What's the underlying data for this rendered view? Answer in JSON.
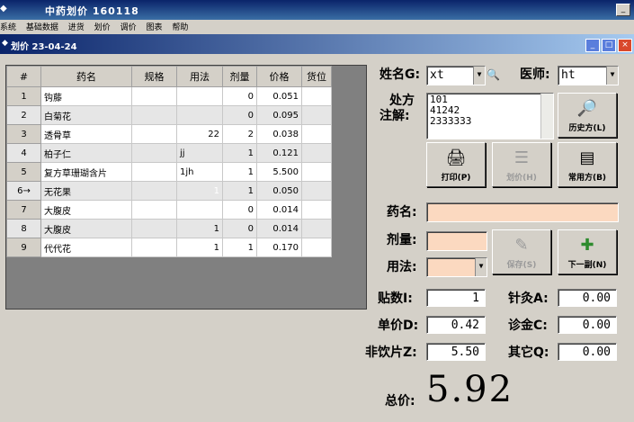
{
  "app": {
    "title": "中药划价 160118",
    "menu": [
      "系统",
      "基础数据",
      "进货",
      "划价",
      "调价",
      "图表",
      "帮助"
    ]
  },
  "window": {
    "title": "划价 23-04-24"
  },
  "grid": {
    "columns": [
      "#",
      "药名",
      "规格",
      "用法",
      "剂量",
      "价格",
      "货位"
    ],
    "rows": [
      {
        "no": "1",
        "name": "钩藤",
        "spec": "",
        "usage": "",
        "dose": "0",
        "price": "0.051",
        "loc": ""
      },
      {
        "no": "2",
        "name": "白菊花",
        "spec": "",
        "usage": "",
        "dose": "0",
        "price": "0.095",
        "loc": ""
      },
      {
        "no": "3",
        "name": "透骨草",
        "spec": "",
        "usage": "22",
        "dose": "2",
        "price": "0.038",
        "loc": ""
      },
      {
        "no": "4",
        "name": "柏子仁",
        "spec": "",
        "usage": "jj",
        "dose": "1",
        "price": "0.121",
        "loc": ""
      },
      {
        "no": "5",
        "name": "复方草珊瑚含片",
        "spec": "",
        "usage": "1jh",
        "dose": "1",
        "price": "5.500",
        "loc": ""
      },
      {
        "no": "6→",
        "name": "无花果",
        "spec": "",
        "usage": "1",
        "dose": "1",
        "price": "0.050",
        "loc": ""
      },
      {
        "no": "7",
        "name": "大腹皮",
        "spec": "",
        "usage": "",
        "dose": "0",
        "price": "0.014",
        "loc": ""
      },
      {
        "no": "8",
        "name": "大腹皮",
        "spec": "",
        "usage": "1",
        "dose": "0",
        "price": "0.014",
        "loc": ""
      },
      {
        "no": "9",
        "name": "代代花",
        "spec": "",
        "usage": "1",
        "dose": "1",
        "price": "0.170",
        "loc": ""
      }
    ]
  },
  "form": {
    "name_label": "姓名G:",
    "name_value": "xt",
    "doctor_label": "医师:",
    "doctor_value": "ht",
    "notes_label_1": "处方",
    "notes_label_2": "注解:",
    "notes_lines": [
      "101",
      "41242",
      "2333333"
    ],
    "drug_label": "药名:",
    "dose_label": "剂量:",
    "usage_label": "用法:",
    "packs_label": "贴数I:",
    "packs_value": "1",
    "acupuncture_label": "针灸A:",
    "acupuncture_value": "0.00",
    "unit_price_label": "单价D:",
    "unit_price_value": "0.42",
    "consult_label": "诊金C:",
    "consult_value": "0.00",
    "non_decoction_label": "非饮片Z:",
    "non_decoction_value": "5.50",
    "other_label": "其它Q:",
    "other_value": "0.00",
    "total_label": "总价:",
    "total_value": "5.92"
  },
  "buttons": {
    "history": "历史方(L)",
    "print": "打印(P)",
    "price": "划价(H)",
    "common": "常用方(B)",
    "save": "保存(S)",
    "next": "下一副(N)"
  },
  "icons": {
    "search": "magnifier-icon",
    "history": "history-search-icon",
    "print": "printer-icon",
    "price": "price-icon",
    "common": "document-icon",
    "save": "pen-icon",
    "next": "add-icon"
  }
}
